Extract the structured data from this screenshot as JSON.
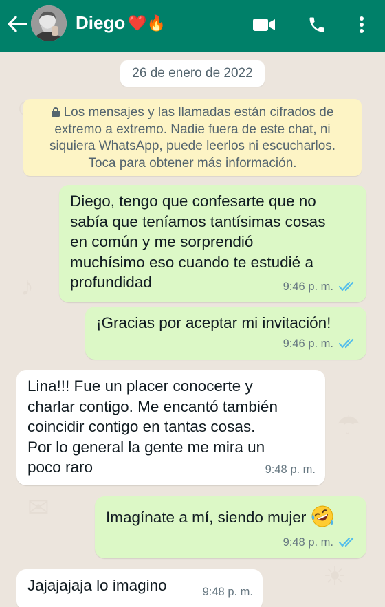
{
  "header": {
    "contact_name": "Diego",
    "name_emojis": "❤️🔥",
    "icons": [
      "back-arrow-icon",
      "video-call-icon",
      "phone-icon",
      "more-vert-icon"
    ],
    "bg_color": "#008069"
  },
  "chat": {
    "date": "26 de enero de 2022",
    "encryption_notice": "Los mensajes y las llamadas están cifrados de extremo a extremo. Nadie fuera de este chat, ni siquiera WhatsApp, puede leerlos ni escucharlos. Toca para obtener más información.",
    "notice_lines": [
      "Los mensajes y las llamadas están cifrados de",
      "extremo a extremo. Nadie fuera de este chat, ni",
      "siquiera WhatsApp, puede leerlos ni escucharlos.",
      "Toca para obtener más información."
    ],
    "messages": [
      {
        "direction": "out",
        "lines": [
          "Diego, tengo que confesarte que no",
          "sabía que teníamos tantísimas cosas",
          "en común y me sorprendió",
          "muchísimo eso cuando te estudié a",
          "profundidad"
        ],
        "time": "9:46 p. m.",
        "read": true
      },
      {
        "direction": "out",
        "lines": [
          "¡Gracias por aceptar mi invitación!"
        ],
        "time": "9:46 p. m.",
        "read": true
      },
      {
        "direction": "in",
        "lines": [
          "Lina!!! Fue un placer conocerte y",
          "charlar contigo. Me encantó también",
          "coincidir contigo en tantas cosas.",
          "Por lo general la gente me mira un",
          "poco raro"
        ],
        "time": "9:48 p. m."
      },
      {
        "direction": "out",
        "lines": [
          "Imagínate a mí, siendo mujer"
        ],
        "emoji": "laughing-rolling-emoji",
        "time": "9:48 p. m.",
        "read": true
      },
      {
        "direction": "in",
        "lines": [
          "Jajajajaja lo imagino"
        ],
        "time": "9:48 p. m."
      }
    ],
    "colors": {
      "outgoing_bubble": "#dcf8c6",
      "incoming_bubble": "#ffffff",
      "read_ticks": "#53bdeb",
      "background": "#ece5dd"
    }
  }
}
